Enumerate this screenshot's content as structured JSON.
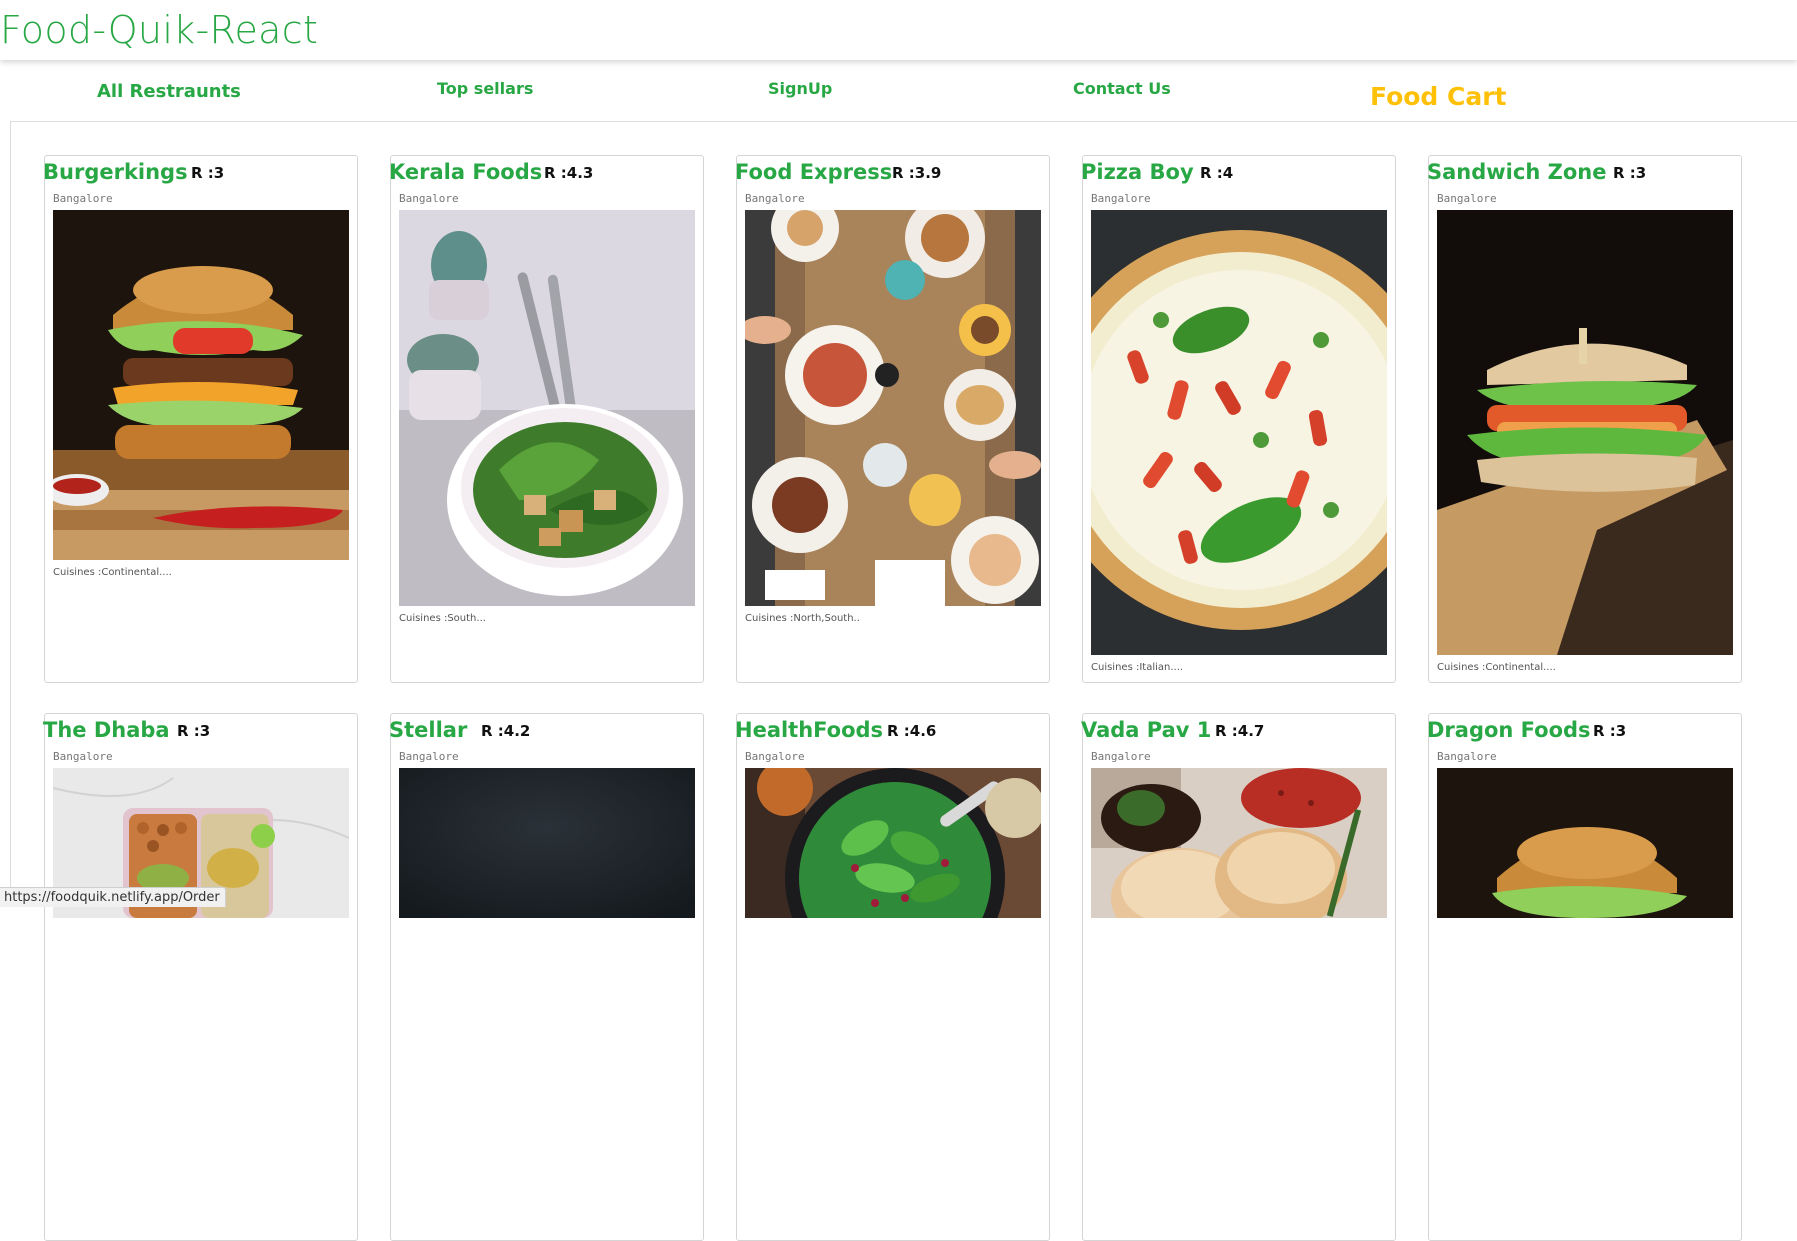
{
  "app": {
    "title": "Food-Quik-React"
  },
  "nav": {
    "all_restaurants": "All Restraunts",
    "top_sellars": "Top sellars",
    "signup": "SignUp",
    "contact": "Contact Us",
    "cart": "Food Cart"
  },
  "colors": {
    "accent": "#28a745",
    "cart": "#ffc107"
  },
  "restaurants": [
    {
      "name": "Burgerkings",
      "rating": "R :3",
      "city": "Bangalore",
      "cuisines": "Cuisines :Continental....",
      "image": "burger-image"
    },
    {
      "name": "Kerala Foods",
      "rating": "R :4.3",
      "city": "Bangalore",
      "cuisines": "Cuisines :South...",
      "image": "salad-bowl-image"
    },
    {
      "name": "Food Express",
      "rating": "R :3.9",
      "city": "Bangalore",
      "cuisines": "Cuisines :North,South..",
      "image": "dining-table-image"
    },
    {
      "name": "Pizza Boy",
      "rating": "R :4",
      "city": "Bangalore",
      "cuisines": "Cuisines :Italian....",
      "image": "pizza-image"
    },
    {
      "name": "Sandwich Zone",
      "rating": "R :3",
      "city": "Bangalore",
      "cuisines": "Cuisines :Continental....",
      "image": "sandwich-image"
    },
    {
      "name": "The Dhaba",
      "rating": "R :3",
      "city": "Bangalore",
      "image": "lunchbox-image"
    },
    {
      "name": "Stellar",
      "rating": "R :4.2",
      "city": "Bangalore",
      "image": "dark-plate-image"
    },
    {
      "name": "HealthFoods",
      "rating": "R :4.6",
      "city": "Bangalore",
      "image": "green-salad-image"
    },
    {
      "name": "Vada Pav 1",
      "rating": "R :4.7",
      "city": "Bangalore",
      "image": "vada-pav-image"
    },
    {
      "name": "Dragon Foods",
      "rating": "R :3",
      "city": "Bangalore",
      "image": "burger-image"
    }
  ],
  "status_bar": {
    "url": "https://foodquik.netlify.app/Order"
  }
}
